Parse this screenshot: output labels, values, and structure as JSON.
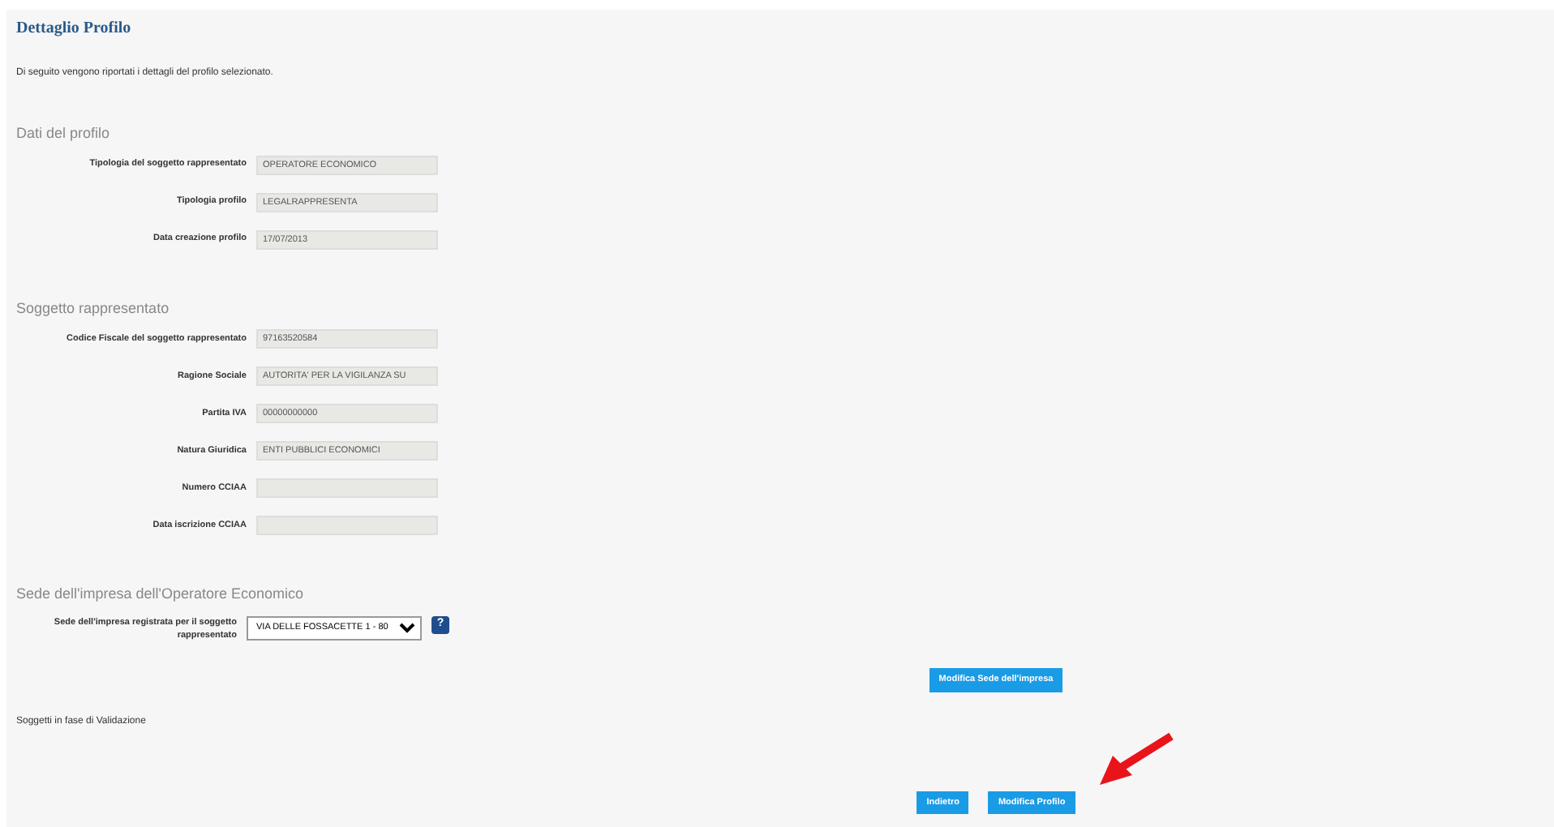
{
  "page": {
    "title": "Dettaglio Profilo",
    "intro": "Di seguito vengono riportati i dettagli del profilo selezionato."
  },
  "sections": [
    {
      "title": "Dati del profilo",
      "fields": [
        {
          "label": "Tipologia del soggetto rappresentato",
          "value": "OPERATORE ECONOMICO"
        },
        {
          "label": "Tipologia profilo",
          "value": "LEGALRAPPRESENTA"
        },
        {
          "label": "Data creazione profilo",
          "value": "17/07/2013"
        }
      ]
    },
    {
      "title": "Soggetto rappresentato",
      "fields": [
        {
          "label": "Codice Fiscale del soggetto rappresentato",
          "value": "97163520584"
        },
        {
          "label": "Ragione Sociale",
          "value": "AUTORITA' PER LA VIGILANZA SU"
        },
        {
          "label": "Partita IVA",
          "value": "00000000000"
        },
        {
          "label": "Natura Giuridica",
          "value": "ENTI PUBBLICI ECONOMICI"
        },
        {
          "label": "Numero CCIAA"
        },
        {
          "label": "Data iscrizione CCIAA"
        }
      ]
    },
    {
      "title": "Sede dell'impresa dell'Operatore Economico",
      "select": {
        "label": "Sede dell'impresa registrata per il soggetto rappresentato",
        "value": "VIA DELLE FOSSACETTE 1 - 80"
      },
      "help": "?"
    }
  ],
  "edit_seat_button": "Modifica Sede dell'impresa",
  "pending_note": "Soggetti in fase di Validazione",
  "buttons": [
    "Indietro",
    "Modifica Profilo"
  ]
}
